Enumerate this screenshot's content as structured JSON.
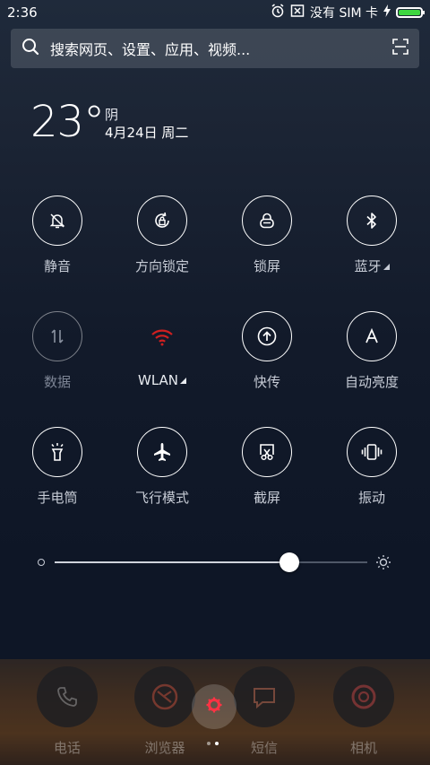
{
  "status_bar": {
    "time": "2:36",
    "carrier": "没有 SIM 卡",
    "battery_level": 1.0,
    "icons": [
      "alarm-icon",
      "close-box-icon",
      "charging-icon",
      "battery-icon"
    ]
  },
  "search": {
    "placeholder": "搜索网页、设置、应用、视频..."
  },
  "weather": {
    "temperature": "23°",
    "condition": "阴",
    "date": "4月24日 周二"
  },
  "toggles": [
    {
      "label": "静音",
      "icon": "bell-off-icon",
      "state": "on"
    },
    {
      "label": "方向锁定",
      "icon": "rotation-lock-icon",
      "state": "on"
    },
    {
      "label": "锁屏",
      "icon": "lock-icon",
      "state": "on"
    },
    {
      "label": "蓝牙",
      "icon": "bluetooth-icon",
      "state": "on"
    },
    {
      "label": "数据",
      "icon": "data-arrows-icon",
      "state": "off"
    },
    {
      "label": "WLAN",
      "icon": "wifi-icon",
      "state": "off"
    },
    {
      "label": "快传",
      "icon": "upload-icon",
      "state": "on"
    },
    {
      "label": "自动亮度",
      "icon": "auto-brightness-icon",
      "state": "on"
    },
    {
      "label": "手电筒",
      "icon": "flashlight-icon",
      "state": "on"
    },
    {
      "label": "飞行模式",
      "icon": "airplane-icon",
      "state": "on"
    },
    {
      "label": "截屏",
      "icon": "screenshot-icon",
      "state": "on"
    },
    {
      "label": "振动",
      "icon": "vibrate-icon",
      "state": "on"
    }
  ],
  "brightness": {
    "value": 0.75
  },
  "dock": {
    "apps": [
      {
        "label": "电话",
        "icon": "phone-icon"
      },
      {
        "label": "浏览器",
        "icon": "browser-icon"
      },
      {
        "label": "短信",
        "icon": "message-icon"
      },
      {
        "label": "相机",
        "icon": "camera-icon"
      }
    ],
    "page_count": 2,
    "active_page": 1
  },
  "colors": {
    "wifi_accent": "#d02020",
    "battery": "#3ed641",
    "center_accent": "#ff3344"
  }
}
